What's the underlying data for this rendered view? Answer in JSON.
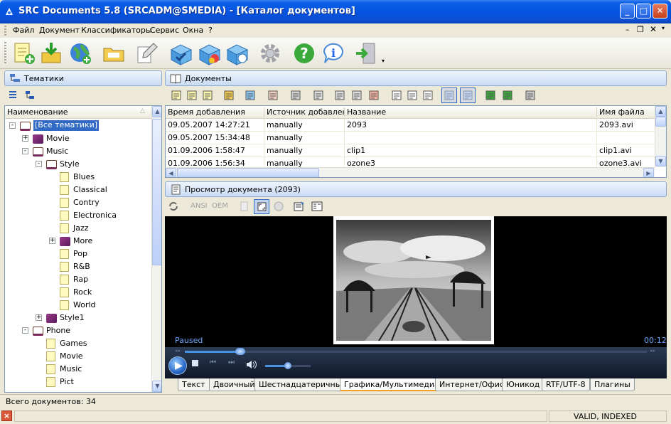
{
  "window": {
    "title": "SRC Documents 5.8 (SRCADM@SMEDIA) - [Каталог документов]"
  },
  "menu": [
    "Файл",
    "Документ",
    "Классификаторы",
    "Сервис",
    "Окна",
    "?"
  ],
  "toolbar": {
    "icons": [
      "new-doc",
      "import",
      "web-globe",
      "open-folder",
      "edit",
      "package-check",
      "package-color",
      "package-globe",
      "gear",
      "help",
      "info",
      "exit"
    ]
  },
  "left_panel": {
    "title": "Тематики",
    "column": "Наименование",
    "tree": [
      {
        "label": "[Все тематики]",
        "depth": 0,
        "kind": "book-open",
        "toggle": "-",
        "selected": true
      },
      {
        "label": "Movie",
        "depth": 1,
        "kind": "book",
        "toggle": "+"
      },
      {
        "label": "Music",
        "depth": 1,
        "kind": "book-open",
        "toggle": "-"
      },
      {
        "label": "Style",
        "depth": 2,
        "kind": "book-open",
        "toggle": "-"
      },
      {
        "label": "Blues",
        "depth": 3,
        "kind": "folder"
      },
      {
        "label": "Classical",
        "depth": 3,
        "kind": "folder"
      },
      {
        "label": "Contry",
        "depth": 3,
        "kind": "folder"
      },
      {
        "label": "Electronica",
        "depth": 3,
        "kind": "folder"
      },
      {
        "label": "Jazz",
        "depth": 3,
        "kind": "folder"
      },
      {
        "label": "More",
        "depth": 3,
        "kind": "book",
        "toggle": "+"
      },
      {
        "label": "Pop",
        "depth": 3,
        "kind": "folder"
      },
      {
        "label": "R&B",
        "depth": 3,
        "kind": "folder"
      },
      {
        "label": "Rap",
        "depth": 3,
        "kind": "folder"
      },
      {
        "label": "Rock",
        "depth": 3,
        "kind": "folder"
      },
      {
        "label": "World",
        "depth": 3,
        "kind": "folder"
      },
      {
        "label": "Style1",
        "depth": 2,
        "kind": "book",
        "toggle": "+"
      },
      {
        "label": "Phone",
        "depth": 1,
        "kind": "book-open",
        "toggle": "-"
      },
      {
        "label": "Games",
        "depth": 2,
        "kind": "folder"
      },
      {
        "label": "Movie",
        "depth": 2,
        "kind": "folder"
      },
      {
        "label": "Music",
        "depth": 2,
        "kind": "folder"
      },
      {
        "label": "Pict",
        "depth": 2,
        "kind": "folder"
      }
    ]
  },
  "documents": {
    "title": "Документы",
    "columns": [
      "Время добавления",
      "Источник добавления",
      "Название",
      "Имя файла"
    ],
    "rows": [
      [
        "09.05.2007 14:27:21",
        "manually",
        "2093",
        "2093.avi"
      ],
      [
        "09.05.2007 15:34:48",
        "manually",
        "",
        ""
      ],
      [
        "01.09.2006 1:58:47",
        "manually",
        "clip1",
        "clip1.avi"
      ],
      [
        "01.09.2006 1:56:34",
        "manually",
        "ozone3",
        "ozone3.avi"
      ]
    ]
  },
  "preview": {
    "title": "Просмотр документа (2093)",
    "ansi": "ANSI",
    "oem": "OEM",
    "status": "Paused",
    "time": "00:12",
    "seek_position": 0.12,
    "volume": 0.5
  },
  "tabs": {
    "items": [
      "Текст",
      "Двоичный",
      "Шестнадцатеричный",
      "Графика/Мультимедиа",
      "Интернет/Офис",
      "Юникод",
      "RTF/UTF-8",
      "Плагины"
    ],
    "active": 3
  },
  "status": {
    "total": "Всего документов: 34",
    "flags": "VALID, INDEXED"
  },
  "colors": {
    "titlebar": "#0553e0",
    "selection": "#316ac5",
    "video_bg": "#000000",
    "player_accent": "#4a90e2",
    "status_text": "#6fa8ff"
  }
}
